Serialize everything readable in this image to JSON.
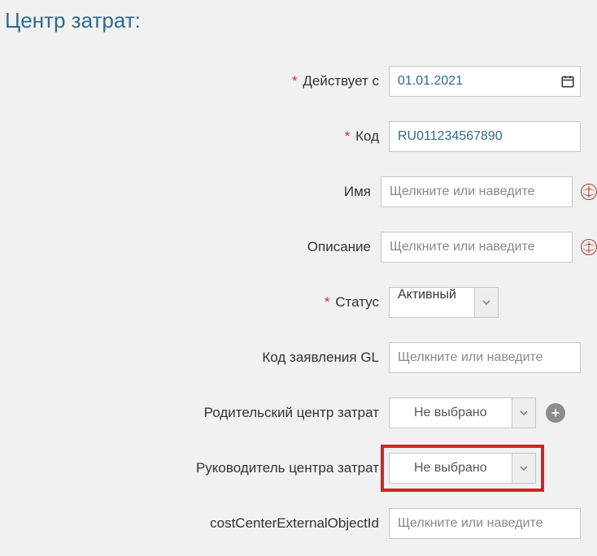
{
  "title": "Центр затрат:",
  "labels": {
    "validFrom": "Действует с",
    "code": "Код",
    "name": "Имя",
    "description": "Описание",
    "status": "Статус",
    "glCode": "Код заявления GL",
    "parentCC": "Родительский центр затрат",
    "ccManager": "Руководитель центра затрат",
    "extObjId": "costCenterExternalObjectId"
  },
  "values": {
    "validFrom": "01.01.2021",
    "code": "RU011234567890",
    "status": "Активный",
    "parentCC": "Не выбрано",
    "ccManager": "Не выбрано"
  },
  "placeholders": {
    "clickOrHover": "Щелкните или наведите"
  }
}
